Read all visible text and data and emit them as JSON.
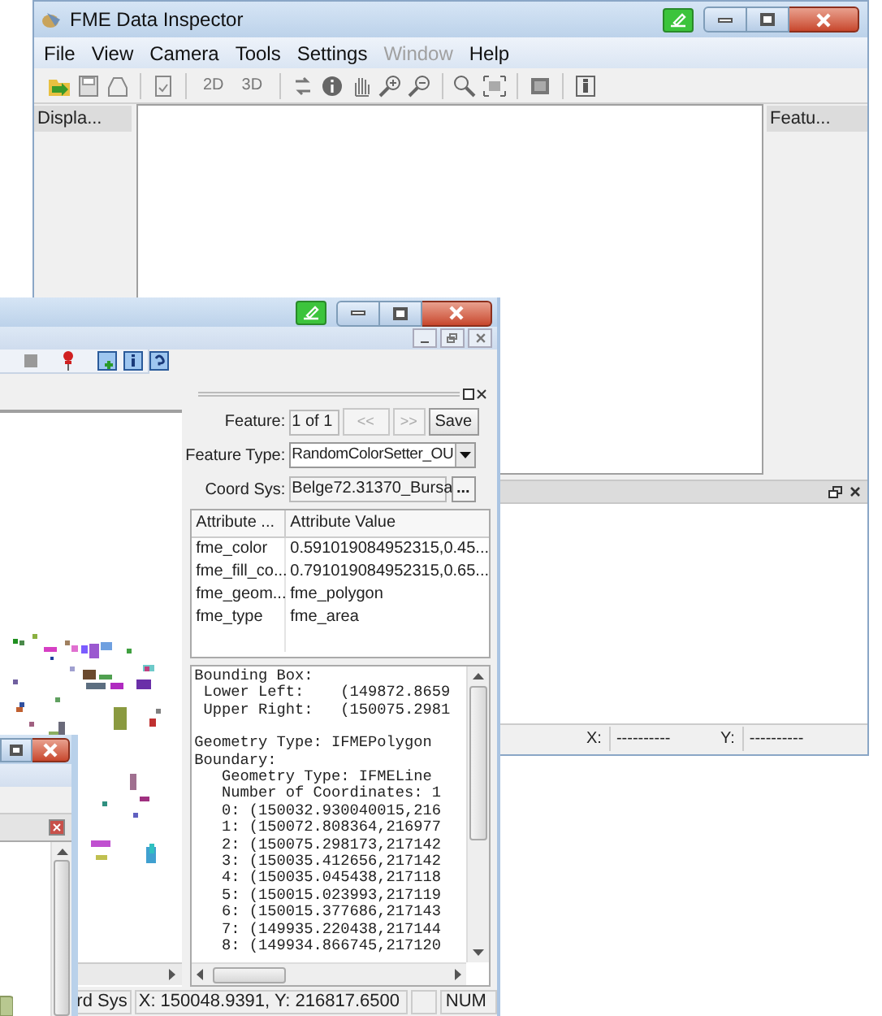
{
  "main_window": {
    "title": "FME Data Inspector",
    "menu": [
      {
        "label": "File",
        "disabled": false
      },
      {
        "label": "View",
        "disabled": false
      },
      {
        "label": "Camera",
        "disabled": false
      },
      {
        "label": "Tools",
        "disabled": false
      },
      {
        "label": "Settings",
        "disabled": false
      },
      {
        "label": "Window",
        "disabled": true
      },
      {
        "label": "Help",
        "disabled": false
      }
    ],
    "toolbar_text_buttons": [
      "2D",
      "3D"
    ],
    "left_panel": {
      "title": "Displa..."
    },
    "right_panel": {
      "title": "Featu..."
    },
    "status_bar": {
      "x_label": "X:",
      "x_value": "----------",
      "y_label": "Y:",
      "y_value": "----------"
    }
  },
  "front_window": {
    "feature_panel": {
      "feature_label": "Feature:",
      "feature_value": "1 of 1",
      "prev": "<<",
      "next": ">>",
      "save": "Save",
      "type_label": "Feature Type:",
      "type_value": "RandomColorSetter_OU",
      "coord_label": "Coord Sys:",
      "coord_value": "Belge72.31370_Bursa",
      "coord_button": "...",
      "table": {
        "columns": [
          "Attribute ...",
          "Attribute Value"
        ],
        "rows": [
          [
            "fme_color",
            "0.591019084952315,0.45..."
          ],
          [
            "fme_fill_co...",
            "0.791019084952315,0.65..."
          ],
          [
            "fme_geom...",
            "fme_polygon"
          ],
          [
            "fme_type",
            "fme_area"
          ]
        ]
      },
      "details_blocks": [
        [
          "Bounding Box:",
          " Lower Left:    (149872.8659",
          " Upper Right:   (150075.2981"
        ],
        [
          "Geometry Type: IFMEPolygon",
          "Boundary:",
          "   Geometry Type: IFMELine",
          "   Number of Coordinates: 1",
          "   0: (150032.930040015,216",
          "   1: (150072.808364,216977",
          "   2: (150075.298173,217142",
          "   3: (150035.412656,217142",
          "   4: (150035.045438,217118",
          "   5: (150015.023993,217119",
          "   6: (150015.377686,217143",
          "   7: (149935.220438,217144",
          "   8: (149934.866745,217120"
        ]
      ]
    },
    "status_bar": {
      "coord_sys": "rd Sys",
      "position": "X: 150048.9391, Y: 216817.6500",
      "num": "NUM"
    }
  }
}
